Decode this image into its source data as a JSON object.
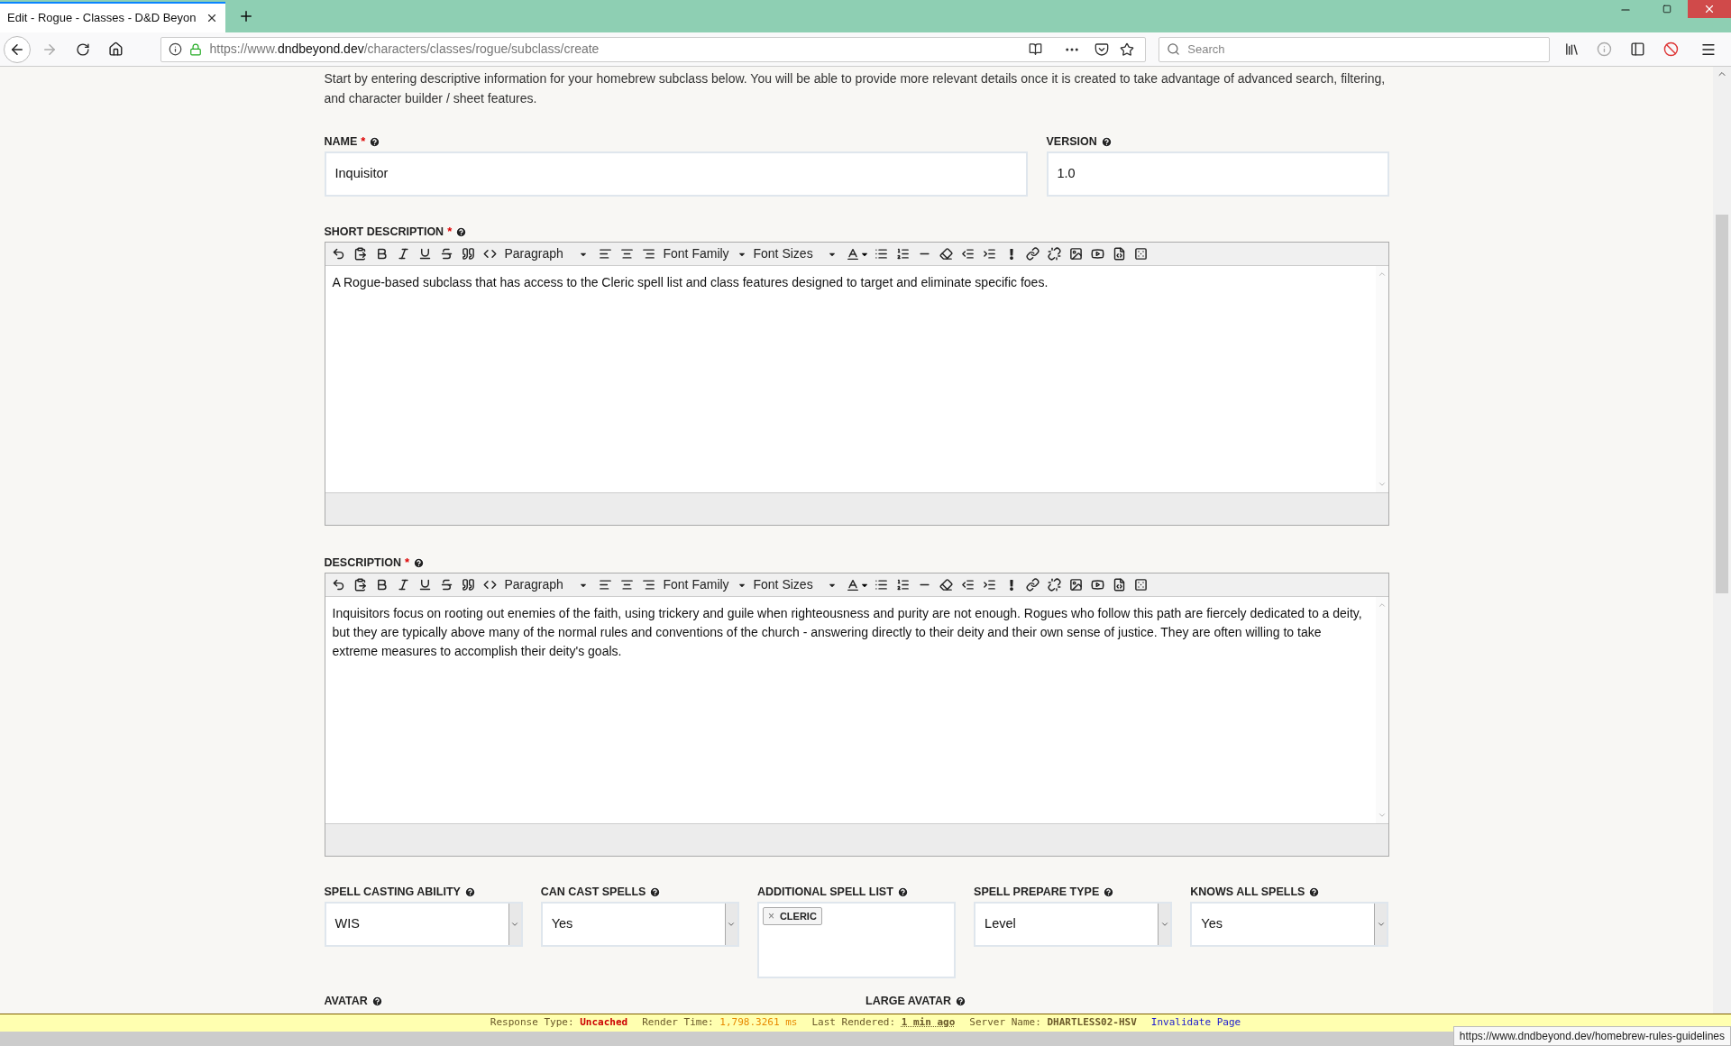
{
  "browser": {
    "tab": {
      "title": "Edit - Rogue - Classes - D&D Beyon",
      "selected": true
    },
    "url": {
      "scheme": "https://www.",
      "domain": "dndbeyond.dev",
      "path": "/characters/classes/rogue/subclass/create"
    },
    "search": {
      "placeholder": "Search"
    }
  },
  "intro": "Start by entering descriptive information for your homebrew subclass below. You will be able to provide more relevant details once it is created to take advantage of advanced search, filtering, and character builder / sheet features.",
  "top_fields": [
    {
      "label": "NAME",
      "required_mark": "*",
      "value": "Inquisitor"
    },
    {
      "label": "VERSION",
      "value": "1.0"
    }
  ],
  "editors": [
    {
      "label": "SHORT DESCRIPTION",
      "required_mark": "*",
      "dropdowns": [
        "Paragraph",
        "Font Family",
        "Font Sizes"
      ],
      "text": "A Rogue-based subclass that has access to the Cleric spell list and class features designed to target and eliminate specific foes."
    },
    {
      "label": "DESCRIPTION",
      "required_mark": "*",
      "dropdowns": [
        "Paragraph",
        "Font Family",
        "Font Sizes"
      ],
      "text": "Inquisitors focus on rooting out enemies of the faith, using trickery and guile when righteousness and purity are not enough. Rogues who follow this path are fiercely dedicated to a deity, but they are typically above many of the normal rules and conventions of the church - answering directly to their deity and their own sense of justice. They are often willing to take extreme measures to accomplish their deity's goals."
    }
  ],
  "spell_fields": [
    {
      "kind": "select",
      "label": "SPELL CASTING ABILITY",
      "value": "WIS"
    },
    {
      "kind": "select",
      "label": "CAN CAST SPELLS",
      "value": "Yes"
    },
    {
      "kind": "tags",
      "label": "ADDITIONAL SPELL LIST",
      "tags": [
        {
          "remove": "×",
          "label": "CLERIC"
        }
      ]
    },
    {
      "kind": "select",
      "label": "SPELL PREPARE TYPE",
      "value": "Level"
    },
    {
      "kind": "select",
      "label": "KNOWS ALL SPELLS",
      "value": "Yes"
    }
  ],
  "avatar_labels": [
    "AVATAR",
    "LARGE AVATAR"
  ],
  "debug_bar": {
    "items": [
      {
        "label": "Response Type:",
        "value": "Uncached",
        "kind": "error"
      },
      {
        "label": "Render Time:",
        "value": "1,798.3261 ms",
        "kind": "warn"
      },
      {
        "label": "Last Rendered:",
        "value": "1 min ago",
        "kind": "time"
      },
      {
        "label": "Server Name:",
        "value": "DHARTLESS02-HSV",
        "kind": "strong"
      }
    ],
    "link": "Invalidate Page"
  },
  "status_url": "https://www.dndbeyond.dev/homebrew-rules-guidelines"
}
